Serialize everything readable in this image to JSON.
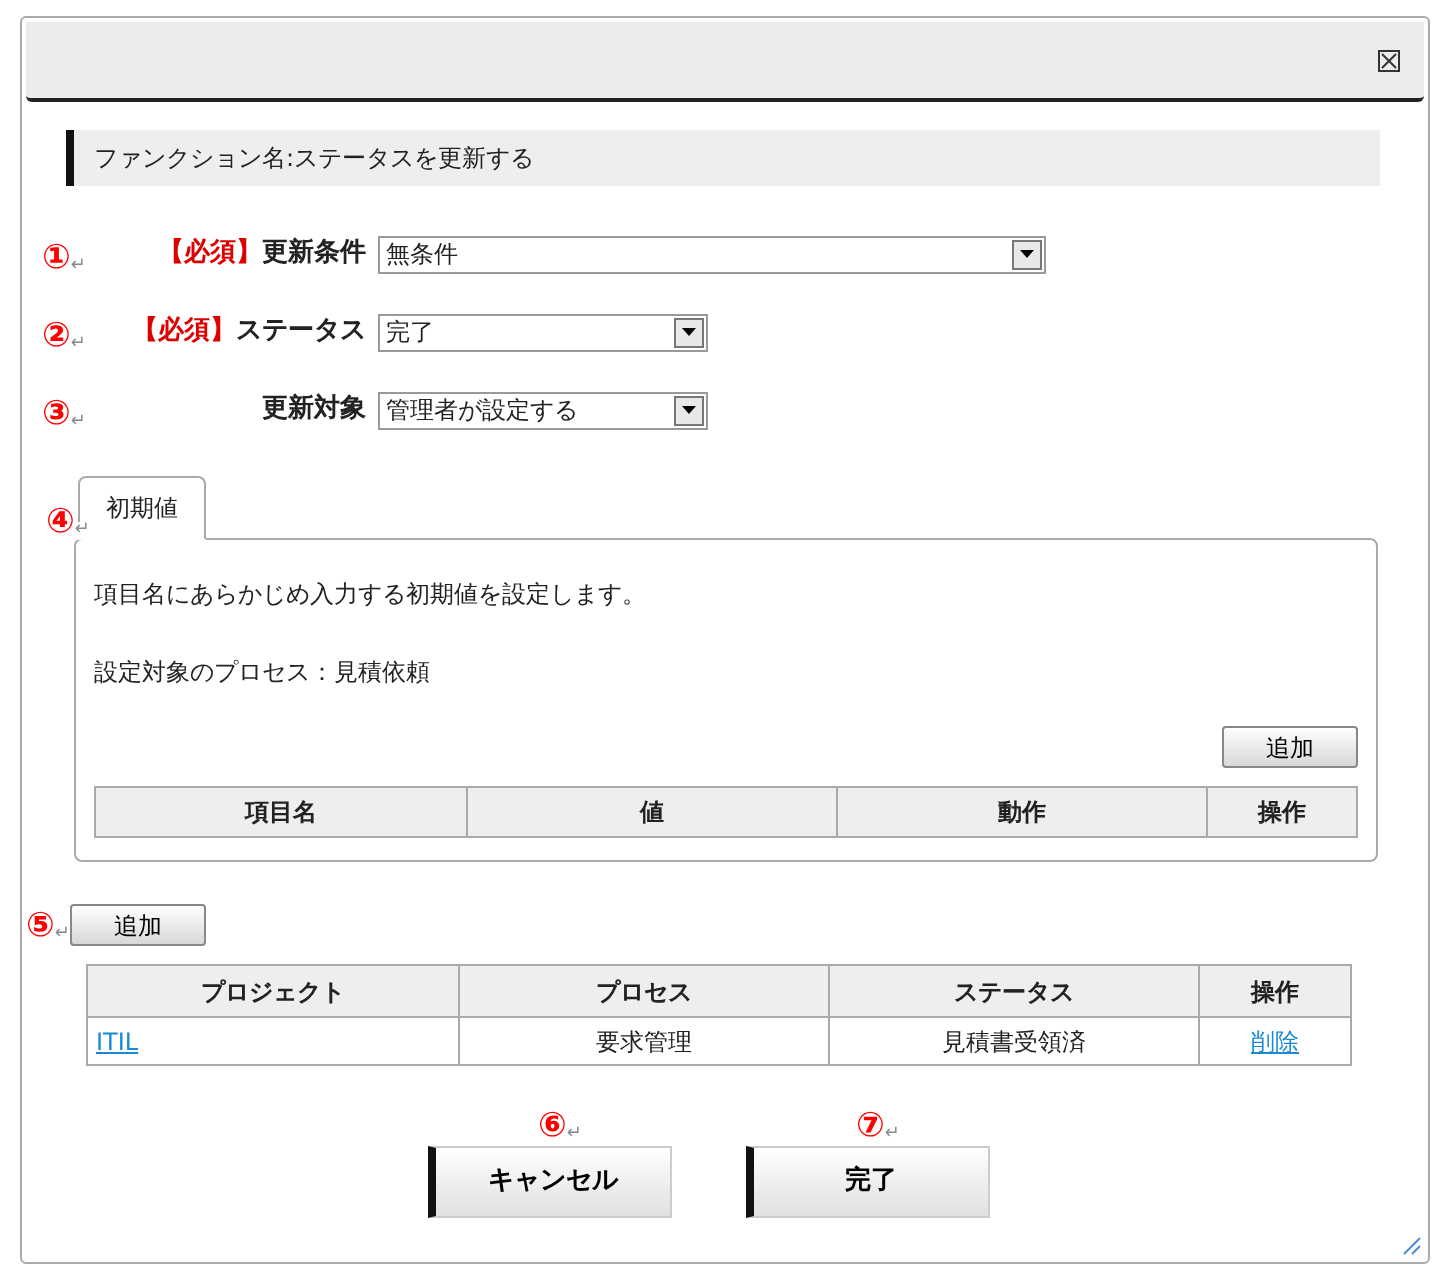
{
  "function_title": "ファンクション名:ステータスを更新する",
  "fields": [
    {
      "marker": "①",
      "return_mark": "↵",
      "required_tag": "【必須】",
      "label": "更新条件",
      "value": "無条件",
      "kind": "long"
    },
    {
      "marker": "②",
      "return_mark": "↵",
      "required_tag": "【必須】",
      "label": "ステータス",
      "value": "完了",
      "kind": "short"
    },
    {
      "marker": "③",
      "return_mark": "↵",
      "label": "更新対象",
      "value": "管理者が設定する",
      "kind": "short"
    }
  ],
  "initial_values": {
    "marker": "④",
    "return_mark": "↵",
    "tab": {
      "label": "初期値",
      "selected": true
    },
    "description": "項目名にあらかじめ入力する初期値を設定します。",
    "process_line": "設定対象のプロセス：見積依頼",
    "add_button": "追加",
    "columns": [
      "項目名",
      "値",
      "動作",
      "操作"
    ]
  },
  "targets": {
    "marker": "⑤",
    "return_mark": "↵",
    "add_button": "追加",
    "columns": [
      "プロジェクト",
      "プロセス",
      "ステータス",
      "操作"
    ],
    "rows": [
      {
        "cells": [
          {
            "text": "ITIL",
            "kind": "link"
          },
          {
            "text": "要求管理",
            "kind": "text"
          },
          {
            "text": "見積書受領済",
            "kind": "text"
          },
          {
            "text": "削除",
            "kind": "link"
          }
        ]
      }
    ]
  },
  "buttons": [
    {
      "marker": "⑥",
      "return_mark": "↵",
      "label": "キャンセル"
    },
    {
      "marker": "⑦",
      "return_mark": "↵",
      "label": "完了"
    }
  ]
}
